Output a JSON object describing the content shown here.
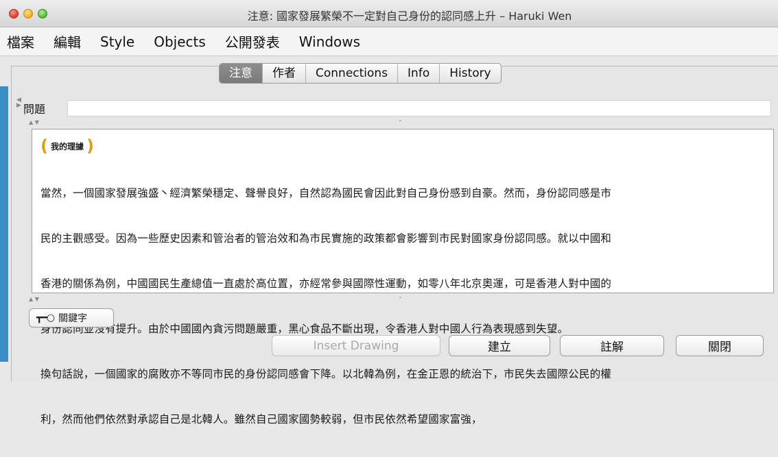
{
  "window": {
    "title": "注意: 國家發展繁榮不一定對自己身份的認同感上升 – Haruki Wen"
  },
  "menu": [
    "檔案",
    "編輯",
    "Style",
    "Objects",
    "公開發表",
    "Windows"
  ],
  "tabs": [
    {
      "label": "注意",
      "active": true
    },
    {
      "label": "作者",
      "active": false
    },
    {
      "label": "Connections",
      "active": false
    },
    {
      "label": "Info",
      "active": false
    },
    {
      "label": "History",
      "active": false
    }
  ],
  "question": {
    "label": "問題",
    "value": ""
  },
  "note": {
    "badge": "我的理據",
    "lines": [
      "當然，一個國家發展強盛丶經濟繁榮穩定、聲譽良好，自然認為國民會因此對自己身份感到自豪。然而，身份認同感是市",
      "民的主觀感受。因為一些歷史因素和管治者的管治效和為市民實施的政策都會影響到市民對國家身份認同感。就以中國和",
      "香港的關係為例，中國國民生產總值一直處於高位置，亦經常參與國際性運動，如零八年北京奧運，可是香港人對中國的",
      "身份認同並沒有提升。由於中國國內貪污問題嚴重，黑心食品不斷出現，令香港人對中國人行為表現感到失望。",
      "換句話說，一個國家的腐敗亦不等同市民的身份認同感會下降。以北韓為例，在金正恩的統治下，市民失去國際公民的權",
      "利，然而他們依然對承認自己是北韓人。雖然自己國家國勢較弱，但市民依然希望國家富強，"
    ]
  },
  "keyword": {
    "label": "關鍵字"
  },
  "buttons": {
    "insert_drawing": "Insert Drawing",
    "create": "建立",
    "comment": "註解",
    "close": "關閉"
  },
  "colors": {
    "accent_blue": "#3b8ec4",
    "active_tab": "#808080",
    "badge_bracket": "#e89a10"
  }
}
